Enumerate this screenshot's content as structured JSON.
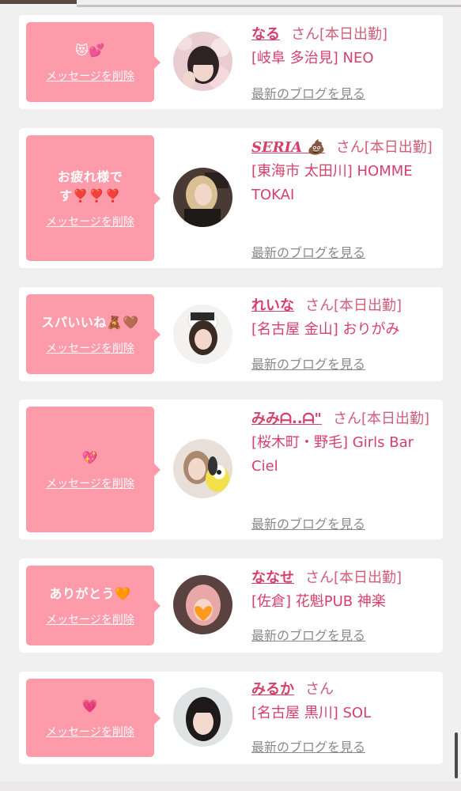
{
  "delete_label": "メッセージを削除",
  "blog_label": "最新のブログを見る",
  "honorific": "さん",
  "status": "[本日出勤]",
  "colors": {
    "bubble": "#fe9bab",
    "accent": "#d73f6b",
    "background": "#f1f0f0"
  },
  "cards": [
    {
      "message": "😻💕",
      "name": "なる",
      "shop": "[岐阜 多治見] NEO",
      "avatar": "avatar-naru"
    },
    {
      "message": "お疲れ様です❣️❣️❣️",
      "name": "SERIA 💩",
      "shop": "[東海市 太田川] HOMME TOKAI",
      "avatar": "avatar-seria"
    },
    {
      "message": "スパいいね🧸🤎",
      "name": "れいな",
      "shop": "[名古屋 金山] おりがみ",
      "avatar": "avatar-reina"
    },
    {
      "message": "💖",
      "name": "みみᗩ..ᗩ\"",
      "shop": "[桜木町・野毛] Girls Bar Ciel",
      "avatar": "avatar-mimi"
    },
    {
      "message": "ありがとう🧡",
      "name": "ななせ",
      "shop": "[佐倉] 花魁PUB 神楽",
      "avatar": "avatar-nanase"
    },
    {
      "message": "💗",
      "name": "みるか",
      "shop": "[名古屋 黒川] SOL",
      "avatar": "avatar-miruka"
    }
  ]
}
